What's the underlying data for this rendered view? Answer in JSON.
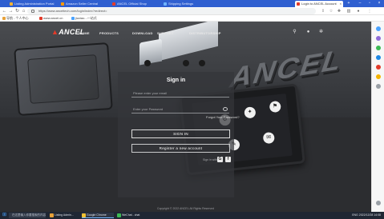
{
  "browser": {
    "tabs": [
      {
        "label": "Listing Administration Portal",
        "active": false
      },
      {
        "label": "Amazon Seller Central",
        "active": false
      },
      {
        "label": "ANCEL Official Shop",
        "active": false
      },
      {
        "label": "Shipping Settings",
        "active": false
      },
      {
        "label": "Login to ANCEL Account",
        "active": true
      }
    ],
    "url": "https://www.anceltech.com/login/index?redirect=",
    "bookmarks": [
      {
        "label": "导航 - 个人中心"
      },
      {
        "label": "www.ancel.cn"
      },
      {
        "label": "jiuxiao...一站式"
      }
    ]
  },
  "site": {
    "logo_text": "ANCEL",
    "nav": [
      "HOME",
      "PRODUCTS",
      "DOWNLOAD",
      "SUPPORT",
      "DISTRIBUTORSHIP"
    ],
    "brand_art_text": "ANCEL"
  },
  "signin": {
    "title": "Sign in",
    "email_placeholder": "Please enter your email",
    "password_placeholder": "Enter your Password",
    "forgot": "Forgot Your Password?",
    "signin_button": "SIGN IN",
    "register_button": "Register a new account",
    "social_label": "Sign in with:",
    "social_icons": [
      "G",
      "f"
    ]
  },
  "footer": {
    "copyright": "Copyright © 2022 ANCEL All Rights Reserved"
  },
  "taskbar": {
    "search_placeholder": "在这里输入你要搜索的内容",
    "items": [
      {
        "label": "Listing Admin...",
        "color": "#e8a23a",
        "active": false
      },
      {
        "label": "Google Chrome",
        "color": "#f1c232",
        "active": true
      },
      {
        "label": "WeChat - chat",
        "color": "#3cba54",
        "active": false
      }
    ],
    "tray": "ENG  2022/12/28  14:08"
  },
  "colors": {
    "accent": "#e23b2a",
    "tab_strip": "#2f5fd0",
    "page_bg": "#34363a"
  }
}
